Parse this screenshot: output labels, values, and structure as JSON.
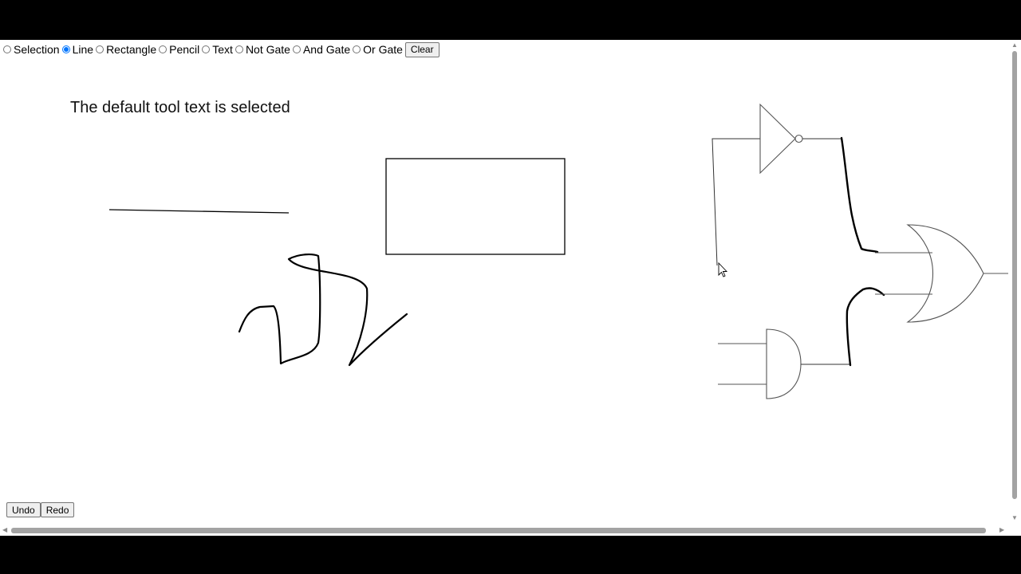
{
  "toolbar": {
    "tools": [
      {
        "label": "Selection",
        "checked": false
      },
      {
        "label": "Line",
        "checked": true
      },
      {
        "label": "Rectangle",
        "checked": false
      },
      {
        "label": "Pencil",
        "checked": false
      },
      {
        "label": "Text",
        "checked": false
      },
      {
        "label": "Not Gate",
        "checked": false
      },
      {
        "label": "And Gate",
        "checked": false
      },
      {
        "label": "Or Gate",
        "checked": false
      }
    ],
    "clear_label": "Clear"
  },
  "canvas": {
    "text_annotation": "The default tool text is selected"
  },
  "history": {
    "undo_label": "Undo",
    "redo_label": "Redo"
  },
  "colors": {
    "stroke": "#000000",
    "gate_stroke": "#555555",
    "background": "#ffffff",
    "frame": "#000000"
  }
}
